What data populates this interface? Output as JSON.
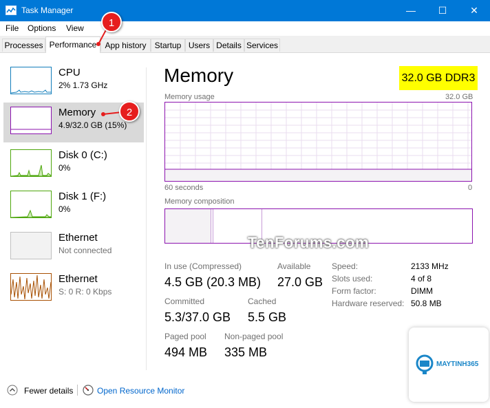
{
  "window": {
    "title": "Task Manager",
    "minimize": "—",
    "maximize": "☐",
    "close": "✕"
  },
  "menu": [
    "File",
    "Options",
    "View"
  ],
  "tabs": [
    "Processes",
    "Performance",
    "App history",
    "Startup",
    "Users",
    "Details",
    "Services"
  ],
  "sidebar": [
    {
      "name": "CPU",
      "sub": "2%  1.73 GHz"
    },
    {
      "name": "Memory",
      "sub": "4.9/32.0 GB (15%)"
    },
    {
      "name": "Disk 0 (C:)",
      "sub": "0%"
    },
    {
      "name": "Disk 1 (F:)",
      "sub": "0%"
    },
    {
      "name": "Ethernet",
      "sub": "Not connected"
    },
    {
      "name": "Ethernet",
      "sub": "S: 0 R: 0 Kbps"
    }
  ],
  "main": {
    "title": "Memory",
    "spec": "32.0 GB DDR3",
    "usage_label": "Memory usage",
    "usage_max": "32.0 GB",
    "time_left": "60 seconds",
    "time_right": "0",
    "composition_label": "Memory composition",
    "watermark": "TenForums.com",
    "stats": {
      "in_use_label": "In use (Compressed)",
      "in_use_value": "4.5 GB (20.3 MB)",
      "available_label": "Available",
      "available_value": "27.0 GB",
      "committed_label": "Committed",
      "committed_value": "5.3/37.0 GB",
      "cached_label": "Cached",
      "cached_value": "5.5 GB",
      "paged_label": "Paged pool",
      "paged_value": "494 MB",
      "nonpaged_label": "Non-paged pool",
      "nonpaged_value": "335 MB"
    },
    "details": [
      {
        "label": "Speed:",
        "value": "2133 MHz"
      },
      {
        "label": "Slots used:",
        "value": "4 of 8"
      },
      {
        "label": "Form factor:",
        "value": "DIMM"
      },
      {
        "label": "Hardware reserved:",
        "value": "50.8 MB"
      }
    ]
  },
  "footer": {
    "fewer_details": "Fewer details",
    "open_monitor": "Open Resource Monitor"
  },
  "callouts": [
    "1",
    "2"
  ],
  "logo": {
    "brand": "MAYTINH365"
  },
  "colors": {
    "titlebar": "#0078d7",
    "memory_accent": "#8b12ae",
    "cpu_accent": "#117dbb",
    "disk_accent": "#4da60c",
    "ethernet_accent": "#a74f01",
    "link": "#0066cc",
    "highlight": "#ffff00",
    "callout": "#e61e1e"
  }
}
